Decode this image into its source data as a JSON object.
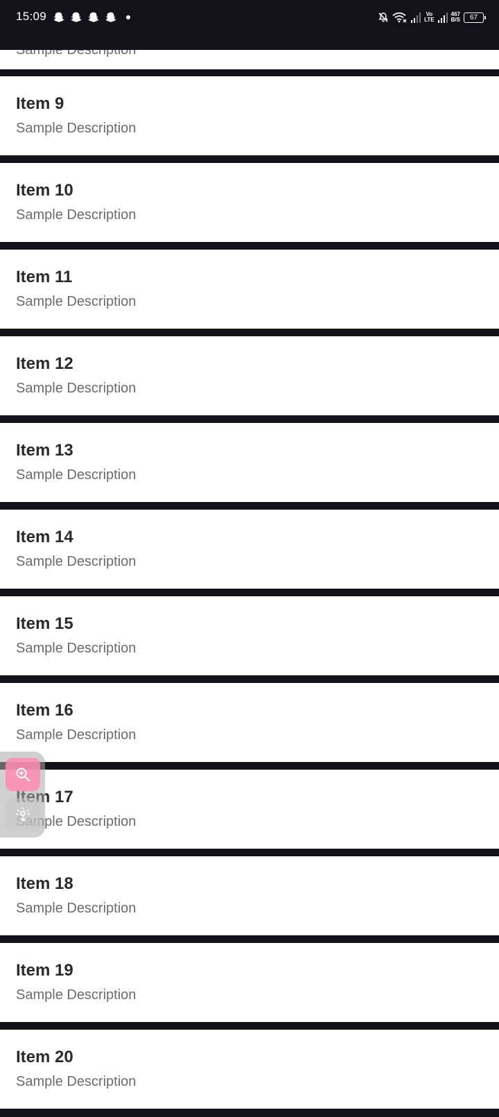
{
  "status_bar": {
    "time": "15:09",
    "network_type": [
      "Vo",
      "LTE"
    ],
    "net_speed": [
      "467",
      "B/S"
    ],
    "battery": "67"
  },
  "list": {
    "partial_top_description": "Sample Description",
    "items": [
      {
        "title": "Item 9",
        "description": "Sample Description"
      },
      {
        "title": "Item 10",
        "description": "Sample Description"
      },
      {
        "title": "Item 11",
        "description": "Sample Description"
      },
      {
        "title": "Item 12",
        "description": "Sample Description"
      },
      {
        "title": "Item 13",
        "description": "Sample Description"
      },
      {
        "title": "Item 14",
        "description": "Sample Description"
      },
      {
        "title": "Item 15",
        "description": "Sample Description"
      },
      {
        "title": "Item 16",
        "description": "Sample Description"
      },
      {
        "title": "Item 17",
        "description": "Sample Description"
      },
      {
        "title": "Item 18",
        "description": "Sample Description"
      },
      {
        "title": "Item 19",
        "description": "Sample Description"
      },
      {
        "title": "Item 20",
        "description": "Sample Description"
      }
    ]
  },
  "floating_tools": {
    "icons": [
      "zoom-in-icon",
      "tap-gesture-icon"
    ]
  },
  "colors": {
    "background": "#13121a",
    "row_background": "#ffffff",
    "title_text": "#2b2b2b",
    "description_text": "#6b6b6b",
    "zoom_button": "#ff8cb4"
  }
}
